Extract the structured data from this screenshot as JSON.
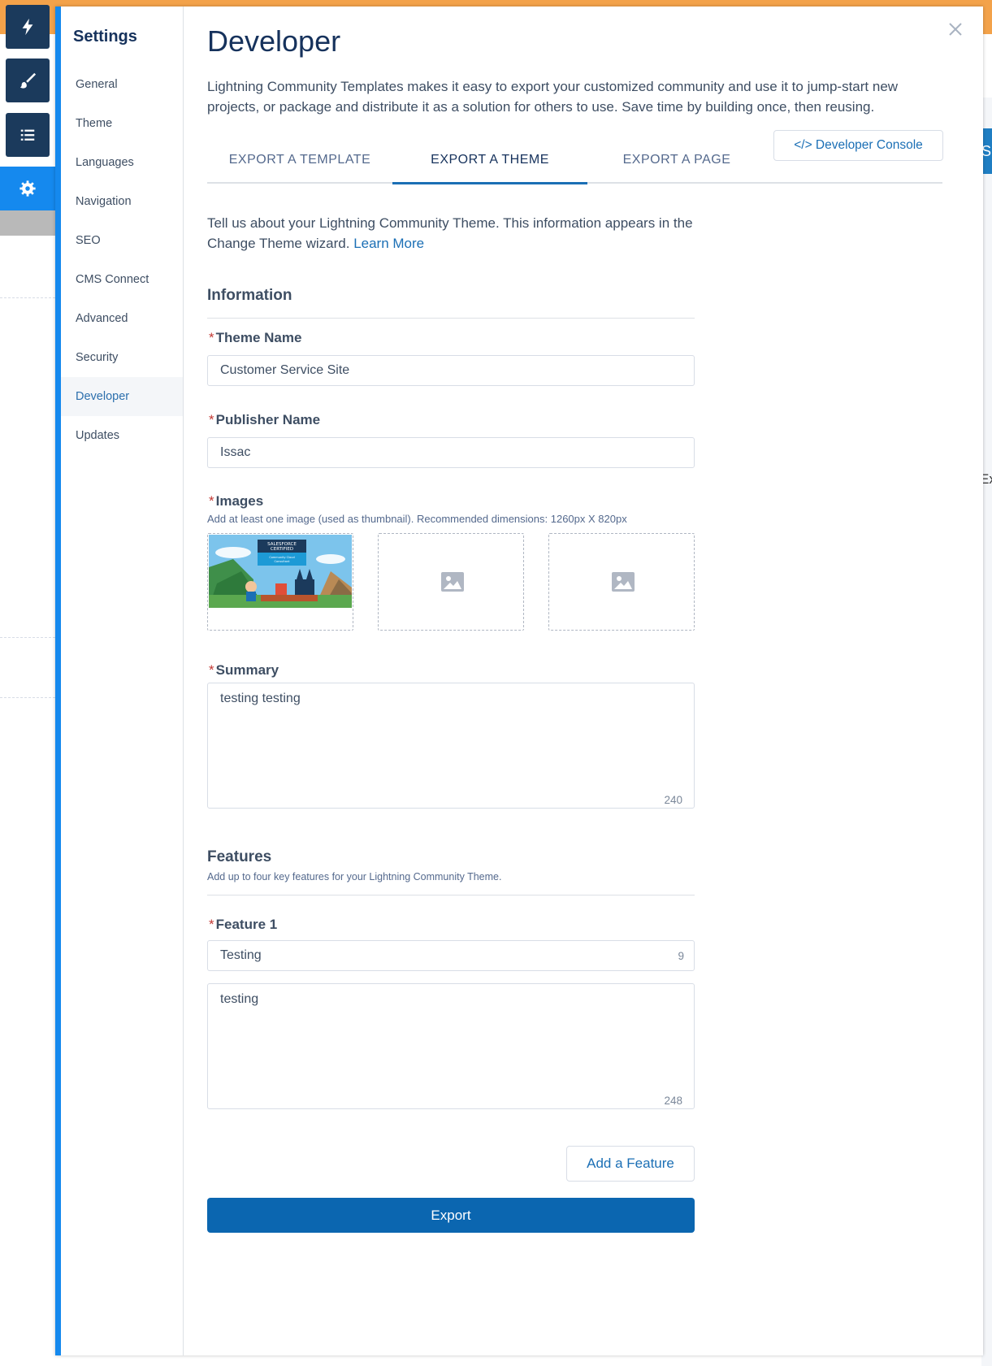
{
  "rail": {
    "items": [
      {
        "name": "lightning",
        "icon": "lightning-icon"
      },
      {
        "name": "paintbrush",
        "icon": "paintbrush-icon"
      },
      {
        "name": "page-list",
        "icon": "list-icon"
      },
      {
        "name": "settings",
        "icon": "gear-icon",
        "active": true
      }
    ]
  },
  "settings": {
    "title": "Settings",
    "nav": [
      "General",
      "Theme",
      "Languages",
      "Navigation",
      "SEO",
      "CMS Connect",
      "Advanced",
      "Security",
      "Developer",
      "Updates"
    ],
    "active": "Developer"
  },
  "page": {
    "title": "Developer",
    "intro": "Lightning Community Templates makes it easy to export your customized community and use it to jump-start new projects, or package and distribute it as a solution for others to use. Save time by building once, then reusing."
  },
  "tabs": [
    "EXPORT A TEMPLATE",
    "EXPORT A THEME",
    "EXPORT A PAGE"
  ],
  "active_tab": "EXPORT A THEME",
  "developer_console": "</> Developer Console",
  "description": {
    "text": "Tell us about your Lightning Community Theme. This information appears in the Change Theme wizard.",
    "link": "Learn More"
  },
  "information": {
    "title": "Information",
    "theme_name_label": "Theme Name",
    "theme_name_value": "Customer Service Site",
    "publisher_name_label": "Publisher Name",
    "publisher_name_value": "Issac",
    "images_label": "Images",
    "images_hint": "Add at least one image (used as thumbnail). Recommended dimensions: 1260px X 820px",
    "thumbnail_text": {
      "line1": "SALESFORCE",
      "line2": "CERTIFIED",
      "line3": "Community Cloud",
      "line4": "Consultant"
    },
    "summary_label": "Summary",
    "summary_value": "testing testing",
    "summary_counter": "240"
  },
  "features": {
    "title": "Features",
    "subtitle": "Add up to four key features for your Lightning Community Theme.",
    "feature1_label": "Feature 1",
    "feature1_title": "Testing",
    "feature1_title_counter": "9",
    "feature1_desc": "testing",
    "feature1_desc_counter": "248",
    "add_button": "Add a Feature"
  },
  "export_button": "Export",
  "required_marker": "*",
  "background": {
    "right_tab_text": "S",
    "right_edge_text": "Ex"
  },
  "colors": {
    "accent": "#1589ee",
    "primary_button": "#0b66b0",
    "link": "#1b6fb5",
    "required": "#c23934"
  }
}
